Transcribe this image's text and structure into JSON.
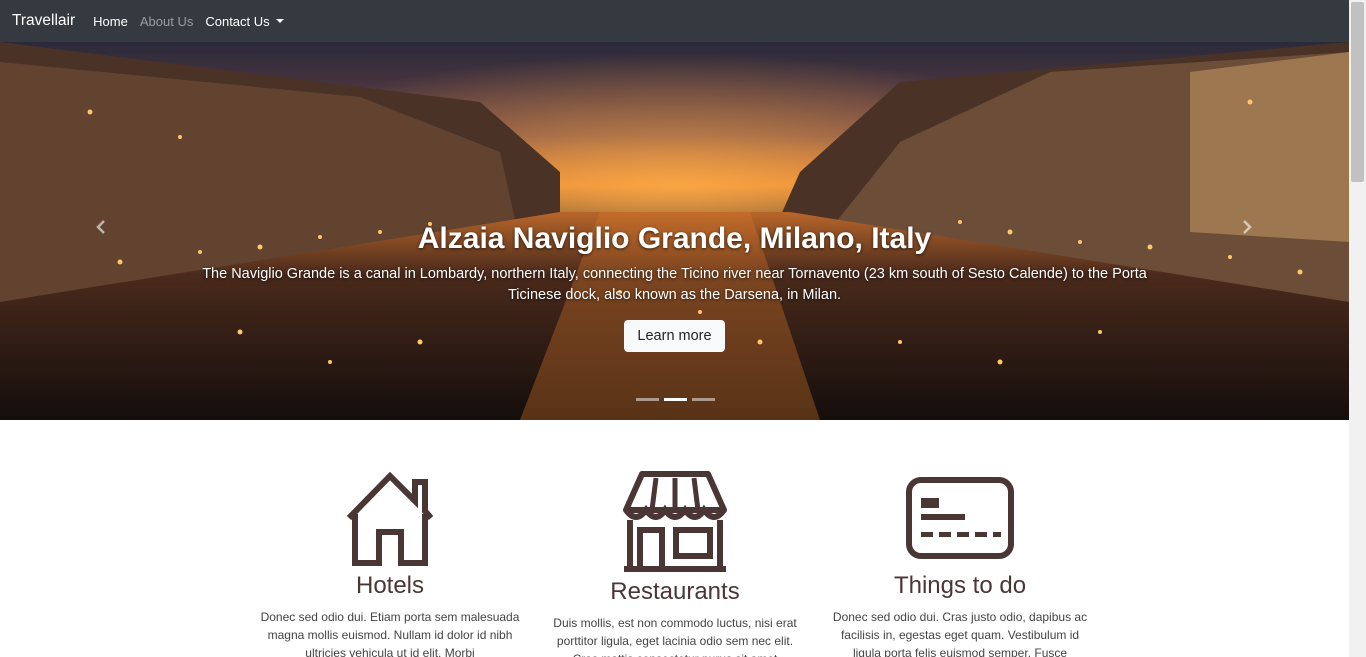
{
  "nav": {
    "brand": "Travellair",
    "links": [
      {
        "label": "Home"
      },
      {
        "label": "About Us"
      },
      {
        "label": "Contact Us"
      }
    ]
  },
  "carousel": {
    "title": "Alzaia Naviglio Grande, Milano, Italy",
    "description": "The Naviglio Grande is a canal in Lombardy, northern Italy, connecting the Ticino river near Tornavento (23 km south of Sesto Calende) to the Porta Ticinese dock, also known as the Darsena, in Milan.",
    "button_label": "Learn more",
    "indicator_count": 3,
    "active_slide": 2
  },
  "features": [
    {
      "icon": "house-icon",
      "title": "Hotels",
      "text": "Donec sed odio dui. Etiam porta sem malesuada magna mollis euismod. Nullam id dolor id nibh ultricies vehicula ut id elit. Morbi"
    },
    {
      "icon": "storefront-icon",
      "title": "Restaurants",
      "text": "Duis mollis, est non commodo luctus, nisi erat porttitor ligula, eget lacinia odio sem nec elit. Cras mattis consectetur purus sit amet"
    },
    {
      "icon": "ticket-icon",
      "title": "Things to do",
      "text": "Donec sed odio dui. Cras justo odio, dapibus ac facilisis in, egestas eget quam. Vestibulum id ligula porta felis euismod semper. Fusce"
    }
  ],
  "colors": {
    "navbar": "#343a40",
    "icon": "#4b3636"
  }
}
